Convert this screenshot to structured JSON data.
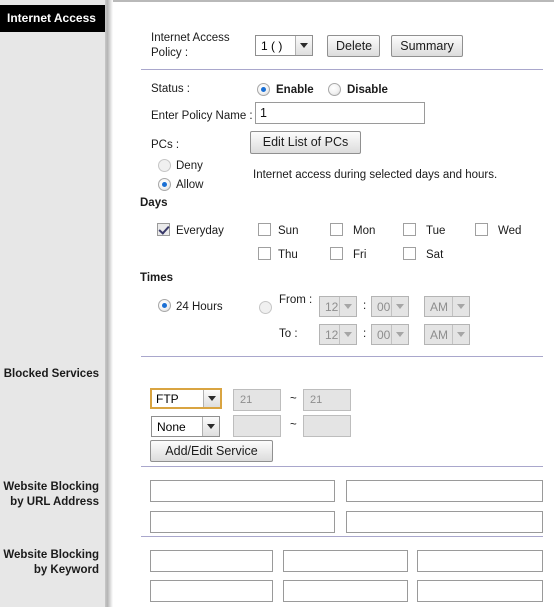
{
  "sidebar": {
    "title": "Internet Access",
    "sections": [
      {
        "line1": "Blocked Services",
        "line2": ""
      },
      {
        "line1": "Website Blocking",
        "line2": "by URL Address"
      },
      {
        "line1": "Website Blocking",
        "line2": "by Keyword"
      }
    ]
  },
  "policy": {
    "label_line1": "Internet Access",
    "label_line2": "Policy  :",
    "selected": "1 ( )",
    "delete_label": "Delete",
    "summary_label": "Summary"
  },
  "status": {
    "label": "Status  :",
    "enable_label": "Enable",
    "disable_label": "Disable",
    "selected": "Enable"
  },
  "policy_name": {
    "label": "Enter Policy Name  :",
    "value": "1"
  },
  "pcs": {
    "label": "PCs  :",
    "button_label": "Edit List of PCs",
    "deny_label": "Deny",
    "allow_label": "Allow",
    "selected": "Allow",
    "note": "Internet access during selected days and hours."
  },
  "days": {
    "heading": "Days",
    "everyday_label": "Everyday",
    "everyday_checked": true,
    "items": [
      {
        "label": "Sun",
        "checked": false
      },
      {
        "label": "Mon",
        "checked": false
      },
      {
        "label": "Tue",
        "checked": false
      },
      {
        "label": "Wed",
        "checked": false
      },
      {
        "label": "Thu",
        "checked": false
      },
      {
        "label": "Fri",
        "checked": false
      },
      {
        "label": "Sat",
        "checked": false
      }
    ]
  },
  "times": {
    "heading": "Times",
    "allday_label": "24 Hours",
    "selected": "24 Hours",
    "from_label": "From :",
    "to_label": "To  :",
    "colon": ":",
    "from_hour": "12",
    "from_minute": "00",
    "from_meridiem": "AM",
    "to_hour": "12",
    "to_minute": "00",
    "to_meridiem": "AM"
  },
  "blocked_services": {
    "rows": [
      {
        "service": "FTP",
        "port_start": "21",
        "port_end": "21",
        "tilde": "~",
        "focused": true
      },
      {
        "service": "None",
        "port_start": "",
        "port_end": "",
        "tilde": "~",
        "focused": false
      }
    ],
    "add_edit_label": "Add/Edit Service"
  },
  "website_url": {
    "fields": [
      "",
      "",
      "",
      ""
    ]
  },
  "website_keyword": {
    "fields": [
      "",
      "",
      "",
      "",
      "",
      ""
    ]
  },
  "colors": {
    "sidebar_bg": "#e7e7e7",
    "title_bg": "#000000",
    "rule": "#a9a7cc",
    "focus_ring": "#d9a441",
    "radio_dot": "#1a6fd4"
  }
}
